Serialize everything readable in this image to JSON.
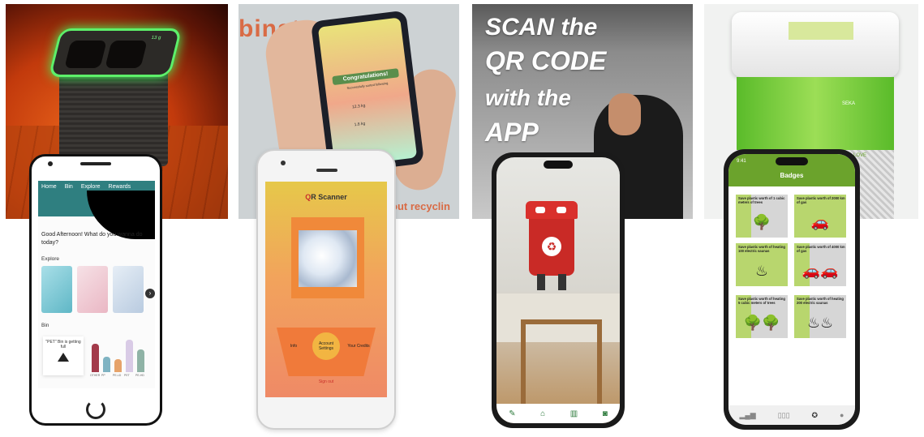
{
  "panel1": {
    "bin_display": "13 g",
    "nav": [
      "Home",
      "Bin",
      "Explore",
      "Rewards"
    ],
    "greeting": "Good Afternoon! What do you wanna do today?",
    "explore_label": "Explore",
    "bin_label": "Bin",
    "alert_text": "\"PET\" Bin is getting full",
    "chart_labels": [
      "OTHER",
      "PP",
      "PE-LD",
      "PET",
      "PE-HD"
    ],
    "chart_levels": [
      0.75,
      0.42,
      0.35,
      0.88,
      0.6
    ],
    "chart_colors": [
      "#a33a4a",
      "#7fb3c2",
      "#e6a36a",
      "#d9cbe6",
      "#8fb3a6"
    ]
  },
  "panel2": {
    "brand": "binster",
    "tagline": "out recyclin",
    "held_title": "Congratulations!",
    "held_sub": "Successfully sorted following",
    "held_v1": "12.3 kg",
    "held_v2": "1.8 kg",
    "title_prefix": "Q",
    "title_rest": "R Scanner",
    "menu_left": "Info",
    "menu_center": "Account Settings",
    "menu_right": "Your Credits",
    "sign_out": "Sign out"
  },
  "panel3": {
    "line1": "SCAN the",
    "line2": "QR CODE",
    "line3": "with the",
    "line4": "APP",
    "recycle_icon": "recycle-icon"
  },
  "panel4": {
    "bin_label_1": "SEKA",
    "bin_label_2": "LOVE",
    "time": "9:41",
    "title": "Badges",
    "badges": [
      {
        "text": "Save plastic worth of 1 cubic meters of trees",
        "icon": "🌳"
      },
      {
        "text": "Save plastic worth of 2000 km of gas",
        "icon": "🚗"
      },
      {
        "text": "Save plastic worth of heating 100 electric saunas",
        "icon": "♨"
      },
      {
        "text": "Save plastic worth of 4000 km of gas",
        "icon": "🚗🚗"
      },
      {
        "text": "Save plastic worth of heating 5 cubic meters of trees",
        "icon": "🌳🌳"
      },
      {
        "text": "Save plastic worth of heating 200 electric saunas",
        "icon": "♨♨"
      }
    ]
  }
}
